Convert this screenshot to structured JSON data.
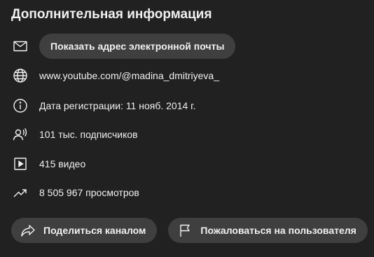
{
  "heading": "Дополнительная информация",
  "email": {
    "icon": "mail-icon",
    "button_label": "Показать адрес электронной почты"
  },
  "url": {
    "icon": "globe-icon",
    "text": "www.youtube.com/@madina_dmitriyeva_"
  },
  "joined": {
    "icon": "info-icon",
    "text": "Дата регистрации: 11 нояб. 2014 г."
  },
  "subscribers": {
    "icon": "subscribers-icon",
    "text": "101 тыс. подписчиков"
  },
  "videos": {
    "icon": "video-icon",
    "text": "415 видео"
  },
  "views": {
    "icon": "trending-icon",
    "text": "8 505 967 просмотров"
  },
  "actions": {
    "share": {
      "icon": "share-icon",
      "label": "Поделиться каналом"
    },
    "report": {
      "icon": "flag-icon",
      "label": "Пожаловаться на пользователя"
    }
  },
  "colors": {
    "background": "#212121",
    "button": "#3f3f3f",
    "text": "#f1f1f1"
  }
}
